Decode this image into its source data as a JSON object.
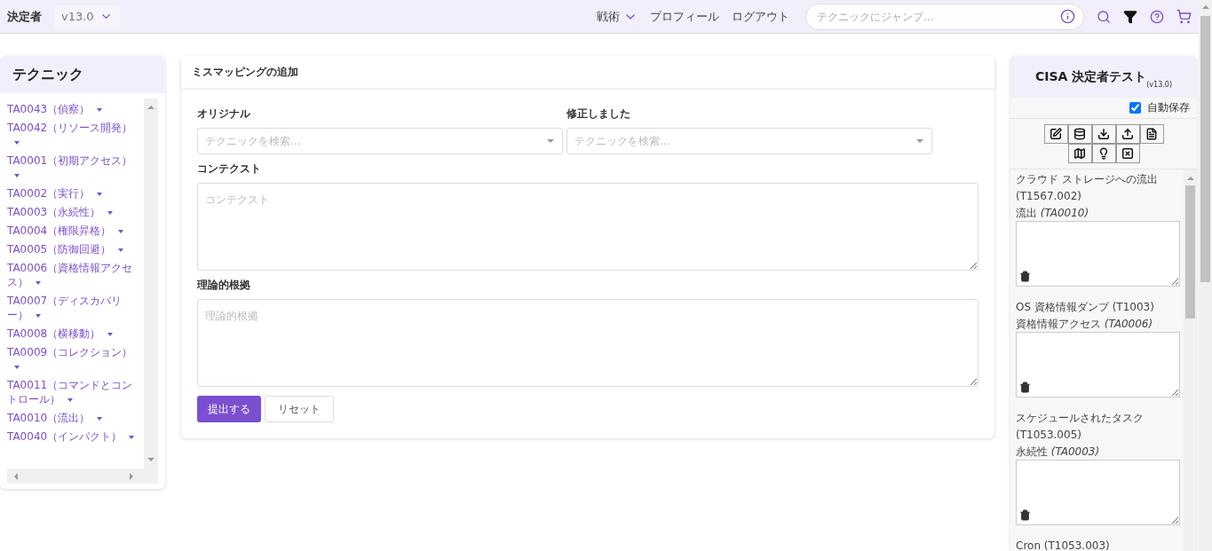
{
  "nav": {
    "brand": "決定者",
    "version": "v13.0",
    "links": [
      {
        "label": "戦術",
        "dropdown": true
      },
      {
        "label": "プロフィール",
        "dropdown": false
      },
      {
        "label": "ログアウト",
        "dropdown": false
      }
    ],
    "search": {
      "placeholder": "テクニックにジャンプ..."
    }
  },
  "sidebar": {
    "title": "テクニック",
    "items": [
      {
        "label": "TA0043（偵察）"
      },
      {
        "label": "TA0042（リソース開発）"
      },
      {
        "label": "TA0001（初期アクセス）"
      },
      {
        "label": "TA0002（実行）"
      },
      {
        "label": "TA0003（永続性）"
      },
      {
        "label": "TA0004（権限昇格）"
      },
      {
        "label": "TA0005（防御回避）"
      },
      {
        "label": "TA0006（資格情報アクセス）"
      },
      {
        "label": "TA0007（ディスカバリー）"
      },
      {
        "label": "TA0008（横移動）"
      },
      {
        "label": "TA0009（コレクション）"
      },
      {
        "label": "TA0011（コマンドとコントロール）"
      },
      {
        "label": "TA0010（流出）"
      },
      {
        "label": "TA0040（インパクト）"
      }
    ]
  },
  "form": {
    "title": "ミスマッピングの追加",
    "original": {
      "label": "オリジナル",
      "placeholder": "テクニックを検索..."
    },
    "corrected": {
      "label": "修正しました",
      "placeholder": "テクニックを検索..."
    },
    "context": {
      "label": "コンテクスト",
      "placeholder": "コンテクスト"
    },
    "rationale": {
      "label": "理論的根拠",
      "placeholder": "理論的根拠"
    },
    "submit": "提出する",
    "reset": "リセット"
  },
  "cart": {
    "title": "CISA 決定者テスト",
    "version": "(v13.0)",
    "autosave": {
      "label": "自動保存",
      "checked": true
    },
    "entries": [
      {
        "name": "クラウド ストレージへの流出 (T1567.002)",
        "tactic": "流出",
        "tactic_id": "(TA0010)"
      },
      {
        "name": "OS 資格情報ダンプ (T1003)",
        "tactic": "資格情報アクセス",
        "tactic_id": "(TA0006)"
      },
      {
        "name": "スケジュールされたタスク (T1053.005)",
        "tactic": "永続性",
        "tactic_id": "(TA0003)"
      },
      {
        "name": "Cron (T1053.003)"
      }
    ]
  }
}
